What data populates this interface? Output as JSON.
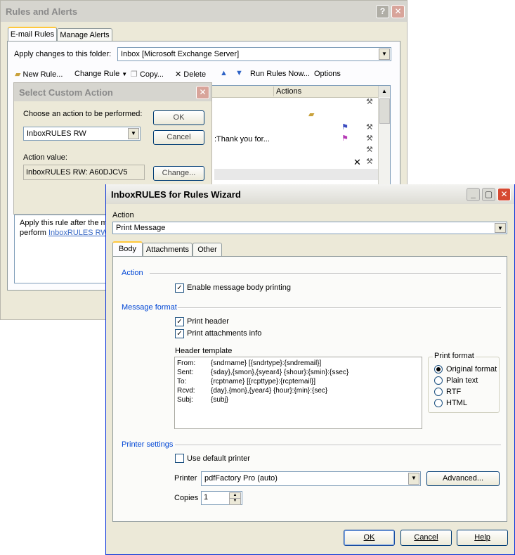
{
  "rules_alerts": {
    "title": "Rules and Alerts",
    "tabs": [
      "E-mail Rules",
      "Manage Alerts"
    ],
    "apply_label": "Apply changes to this folder:",
    "folder_value": "Inbox [Microsoft Exchange Server]",
    "toolbar": {
      "new_rule": "New Rule...",
      "change_rule": "Change Rule",
      "copy": "Copy...",
      "delete": "Delete",
      "run_rules": "Run Rules Now...",
      "options": "Options"
    },
    "list_header_actions": "Actions",
    "row_text": ":Thank you for...",
    "desc_line1": "Apply this rule after the m",
    "desc_line2": "perform",
    "desc_link": "InboxRULES RW"
  },
  "custom_action": {
    "title": "Select Custom Action",
    "choose_label": "Choose an action to be performed:",
    "selected_action": "InboxRULES RW",
    "ok": "OK",
    "cancel": "Cancel",
    "value_label": "Action value:",
    "value": "InboxRULES RW: A60DJCV5",
    "change_button": "Change..."
  },
  "wizard": {
    "title": "InboxRULES for Rules Wizard",
    "action_label": "Action",
    "action_value": "Print Message",
    "tabs": [
      "Body",
      "Attachments",
      "Other"
    ],
    "group_action": "Action",
    "enable_body_printing": "Enable message body printing",
    "group_format": "Message format",
    "print_header": "Print header",
    "print_attachments": "Print attachments info",
    "header_template_label": "Header template",
    "template": [
      {
        "key": "From:",
        "value": "{sndrname} [{sndrtype}:{sndremail}]"
      },
      {
        "key": "Sent:",
        "value": "{sday},{smon},{syear4} {shour}:{smin}:{ssec}"
      },
      {
        "key": "To:",
        "value": "{rcptname} [{rcpttype}:{rcptemail}]"
      },
      {
        "key": "Rcvd:",
        "value": "{day},{mon},{year4} {hour}:{min}:{sec}"
      },
      {
        "key": "Subj:",
        "value": "{subj}"
      }
    ],
    "print_format_label": "Print format",
    "formats": [
      "Original format",
      "Plain text",
      "RTF",
      "HTML"
    ],
    "selected_format": "Original format",
    "group_printer": "Printer settings",
    "use_default_printer": "Use default printer",
    "printer_label": "Printer",
    "printer_value": "pdfFactory Pro (auto)",
    "advanced": "Advanced...",
    "copies_label": "Copies",
    "copies_value": "1",
    "ok": "OK",
    "cancel": "Cancel",
    "help": "Help"
  }
}
